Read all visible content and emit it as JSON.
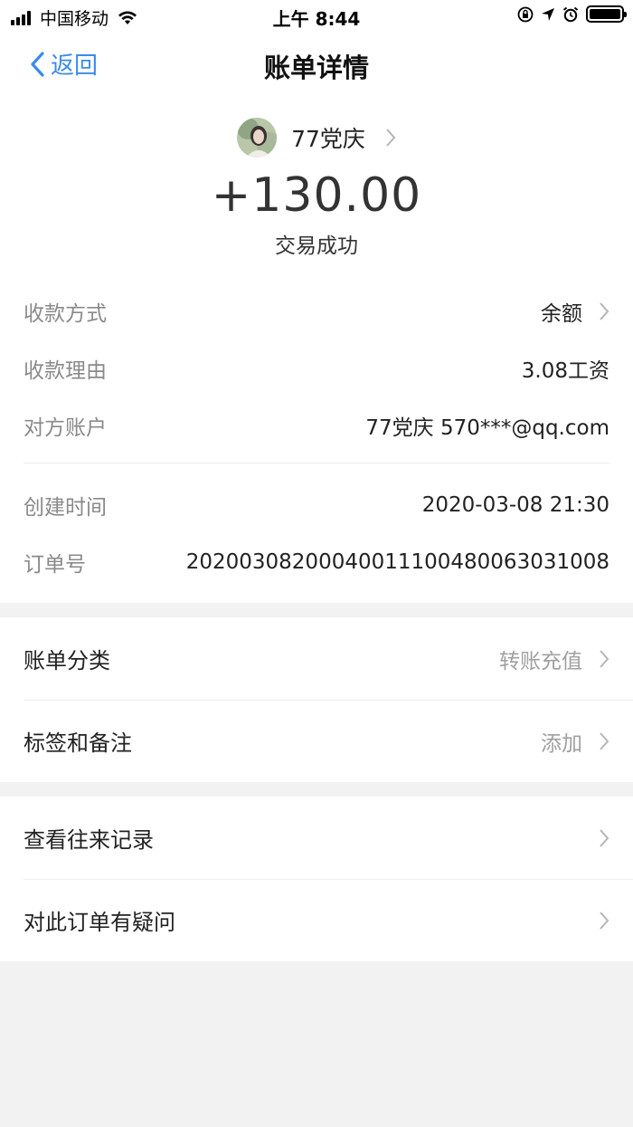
{
  "status_bar": {
    "carrier": "中国移动",
    "time": "上午 8:44",
    "battery_level": 1.0
  },
  "nav": {
    "back_label": "返回",
    "title": "账单详情"
  },
  "header": {
    "payee_name": "77党庆",
    "amount": "+130.00",
    "status": "交易成功"
  },
  "details": [
    {
      "label": "收款方式",
      "value": "余额"
    },
    {
      "label": "收款理由",
      "value": "3.08工资"
    },
    {
      "label": "对方账户",
      "value": "77党庆 570***@qq.com"
    },
    {
      "label": "创建时间",
      "value": "2020-03-08 21:30"
    },
    {
      "label": "订单号",
      "value": "20200308200040011100480063031008"
    }
  ],
  "section1": [
    {
      "label": "账单分类",
      "value": "转账充值"
    },
    {
      "label": "标签和备注",
      "value": "添加"
    }
  ],
  "section2": [
    {
      "label": "查看往来记录"
    },
    {
      "label": "对此订单有疑问"
    }
  ],
  "colors": {
    "accent": "#3b8be8",
    "background": "#f2f2f2",
    "card": "#ffffff"
  }
}
